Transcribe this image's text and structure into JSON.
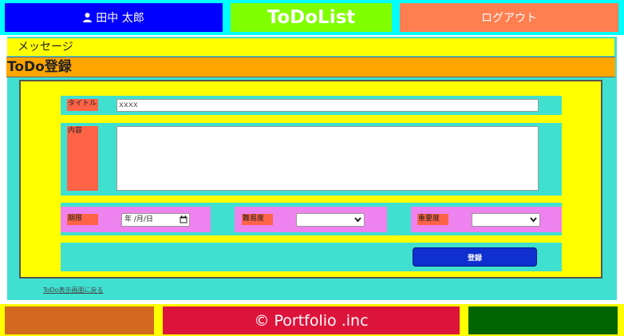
{
  "header": {
    "user_name": "田中 太郎",
    "app_title": "ToDoList",
    "logout_label": "ログアウト"
  },
  "message": "メッセージ",
  "page_title": "ToDo登録",
  "form": {
    "title_label": "タイトル",
    "title_value": "xxxx",
    "content_label": "内容",
    "content_value": "",
    "deadline_label": "期限",
    "deadline_value": "年 /月/日",
    "difficulty_label": "難易度",
    "difficulty_value": "",
    "importance_label": "重要度",
    "importance_value": "",
    "submit_label": "登録"
  },
  "back_link": "ToDo表示画面に戻る",
  "footer": {
    "copyright": "© Portfolio .inc"
  },
  "icons": {
    "user": "user-icon",
    "calendar": "calendar-icon",
    "dropdown": "chevron-down-icon"
  }
}
